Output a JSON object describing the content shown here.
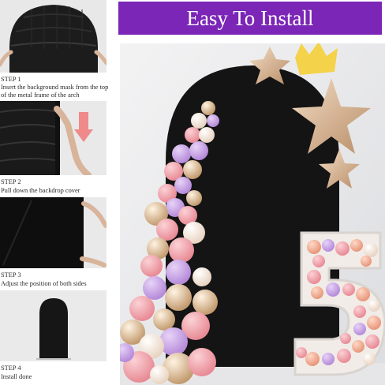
{
  "banner": {
    "title": "Easy To Install"
  },
  "steps": [
    {
      "label": "STEP 1",
      "text": "Insert the background mask from the top of the metal frame of the arch"
    },
    {
      "label": "STEP 2",
      "text": "Pull down the backdrop cover"
    },
    {
      "label": "STEP 3",
      "text": "Adjust the position of  both sides"
    },
    {
      "label": "STEP 4",
      "text": "Install done"
    }
  ],
  "colors": {
    "banner": "#7b26b6",
    "arch": "#151515",
    "arrow": "#f08a8a",
    "balloon_pink": "#f2a0a8",
    "balloon_lilac": "#c9a3e8",
    "balloon_gold": "#d9c3a3",
    "balloon_cream": "#f4e6da"
  },
  "decorations": [
    "star-icon",
    "crown-icon",
    "number-5-marquee"
  ]
}
